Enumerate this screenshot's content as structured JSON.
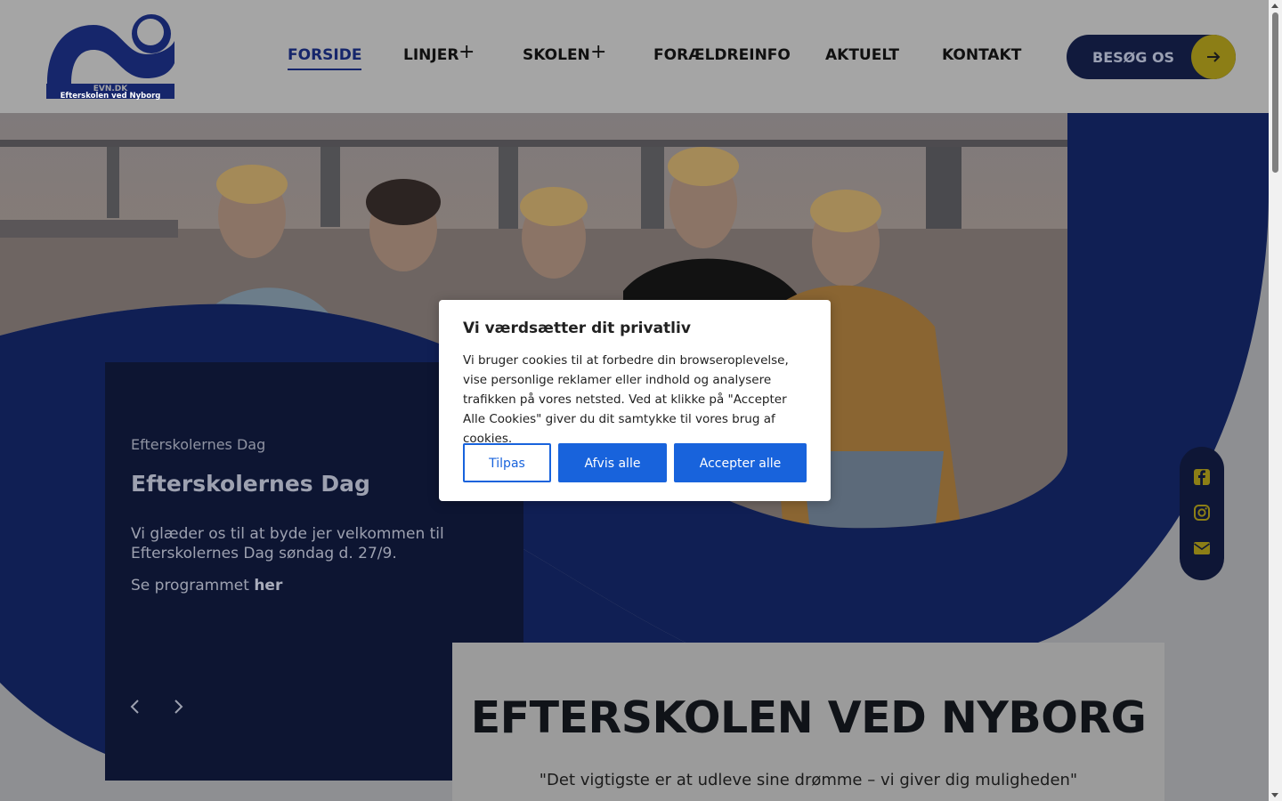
{
  "logo": {
    "wordmark": "EVN.DK",
    "school": "Efterskolen ved Nyborg"
  },
  "nav": {
    "items": [
      {
        "label": "FORSIDE",
        "active": true
      },
      {
        "label": "LINJER",
        "has_submenu": true
      },
      {
        "label": "SKOLEN",
        "has_submenu": true
      },
      {
        "label": "FORÆLDREINFO"
      },
      {
        "label": "AKTUELT"
      },
      {
        "label": "KONTAKT"
      }
    ],
    "submenu_icon": "+",
    "cta": {
      "label": "BESØG OS",
      "icon": "arrow-right-icon"
    }
  },
  "event_card": {
    "eyebrow": "Efterskolernes Dag",
    "title": "Efterskolernes Dag",
    "body": "Vi glæder os til at byde jer velkommen til Efterskolernes Dag søndag d. 27/9.",
    "program_prefix": "Se programmet",
    "program_link": "her",
    "prev_icon": "chevron-left-icon",
    "next_icon": "chevron-right-icon"
  },
  "panel": {
    "heading": "EFTERSKOLEN VED NYBORG",
    "quote": "\"Det vigtigste er at udleve sine drømme – vi giver dig muligheden\""
  },
  "social": {
    "icons": [
      "facebook-icon",
      "instagram-icon",
      "mail-icon"
    ]
  },
  "cookie": {
    "title": "Vi værdsætter dit privatliv",
    "text": "Vi bruger cookies til at forbedre din browseroplevelse, vise personlige reklamer eller indhold og analysere trafikken på vores netsted. Ved at klikke på \"Accepter Alle Cookies\" giver du dit samtykke til vores brug af cookies.",
    "customize": "Tilpas",
    "reject": "Afvis alle",
    "accept": "Accepter alle"
  },
  "colors": {
    "brand_navy": "#16266b",
    "accent_gold": "#c9b422",
    "cookie_blue": "#1863dc"
  }
}
